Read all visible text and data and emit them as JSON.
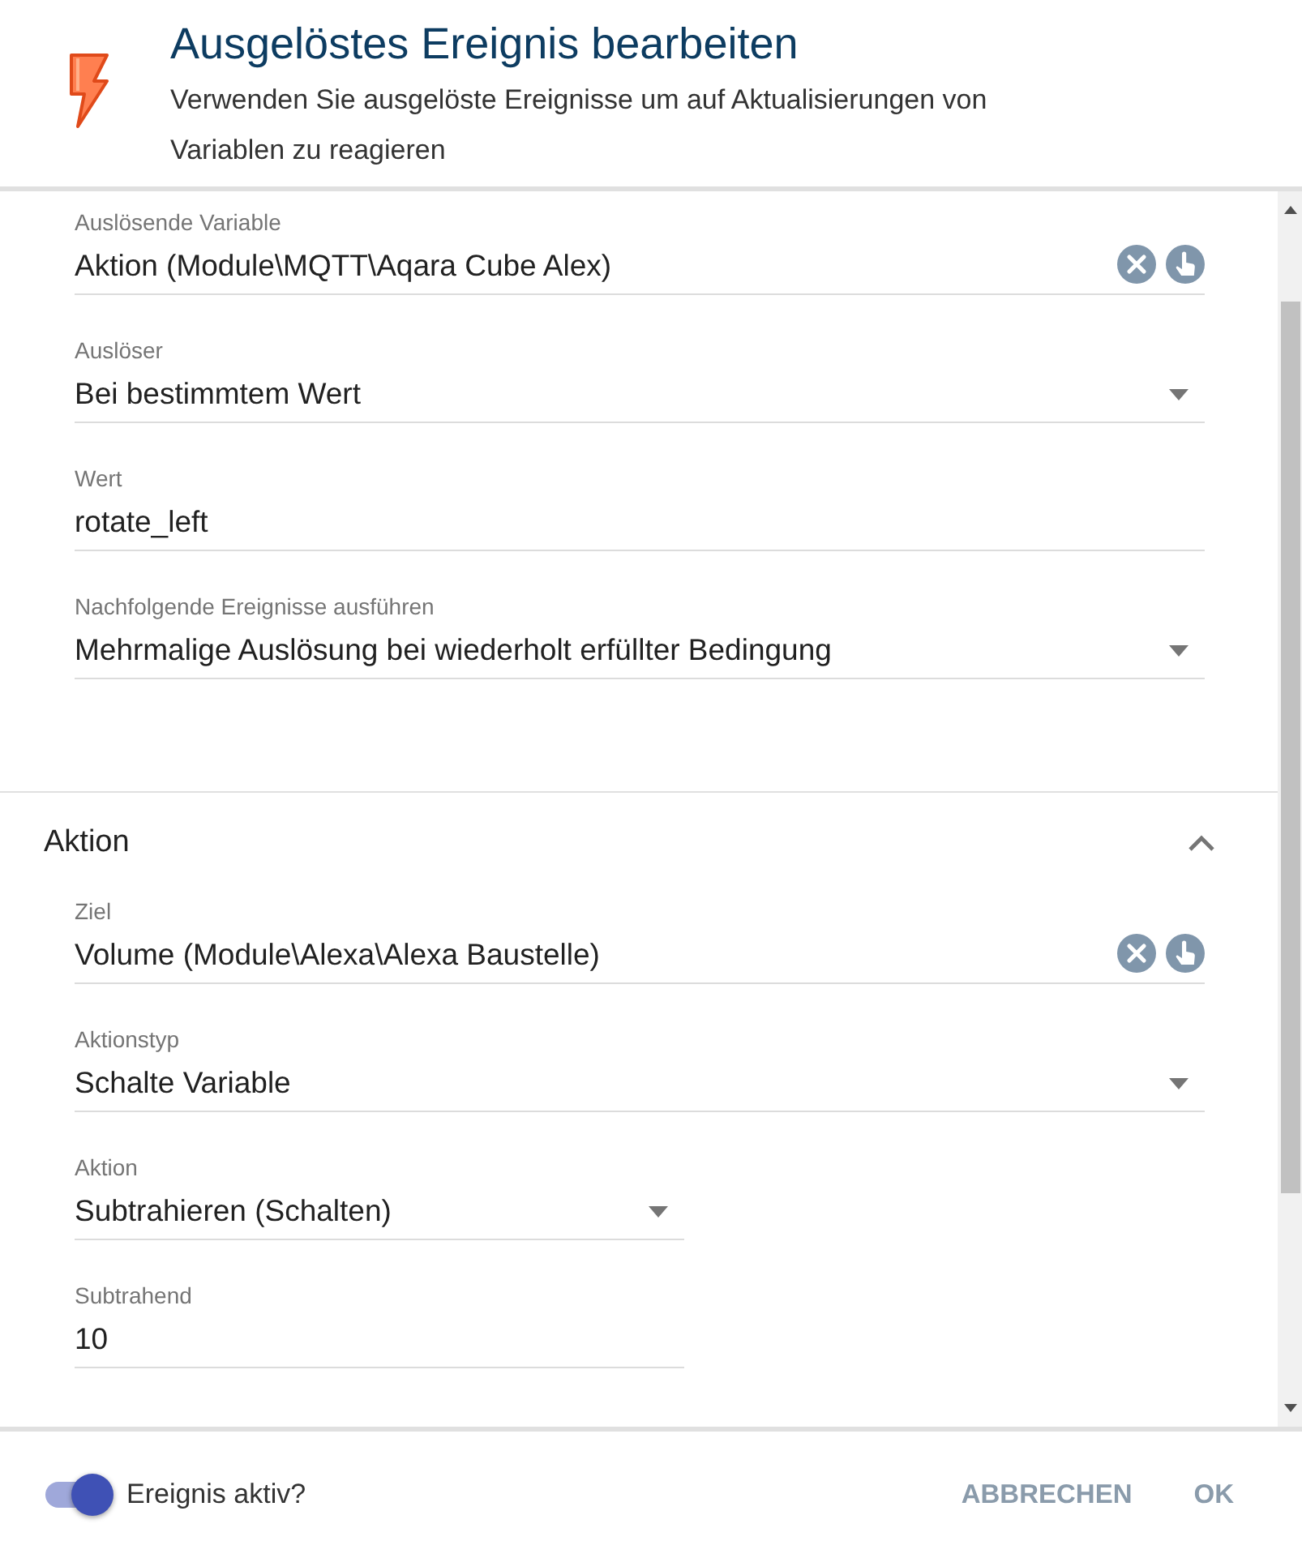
{
  "header": {
    "title": "Ausgelöstes Ereignis bearbeiten",
    "subtitle": "Verwenden Sie ausgelöste Ereignisse um auf Aktualisierungen von Variablen zu reagieren"
  },
  "sections": [
    {
      "fields": [
        {
          "kind": "picker",
          "label": "Auslösende Variable",
          "value": "Aktion (Module\\MQTT\\Aqara Cube Alex)",
          "narrow": false
        },
        {
          "kind": "select",
          "label": "Auslöser",
          "value": "Bei bestimmtem Wert",
          "narrow": false
        },
        {
          "kind": "text",
          "label": "Wert",
          "value": "rotate_left",
          "narrow": false
        },
        {
          "kind": "select",
          "label": "Nachfolgende Ereignisse ausführen",
          "value": "Mehrmalige Auslösung bei wiederholt erfüllter Bedingung",
          "narrow": false
        }
      ]
    },
    {
      "title": "Aktion",
      "expanded": true,
      "fields": [
        {
          "kind": "picker",
          "label": "Ziel",
          "value": "Volume (Module\\Alexa\\Alexa Baustelle)",
          "narrow": false
        },
        {
          "kind": "select",
          "label": "Aktionstyp",
          "value": "Schalte Variable",
          "narrow": false
        },
        {
          "kind": "select",
          "label": "Aktion",
          "value": "Subtrahieren (Schalten)",
          "narrow": true
        },
        {
          "kind": "text",
          "label": "Subtrahend",
          "value": "10",
          "narrow": true
        }
      ]
    }
  ],
  "footer": {
    "toggle": {
      "label": "Ereignis aktiv?",
      "on": true
    },
    "buttons": [
      "ABBRECHEN",
      "OK"
    ]
  }
}
